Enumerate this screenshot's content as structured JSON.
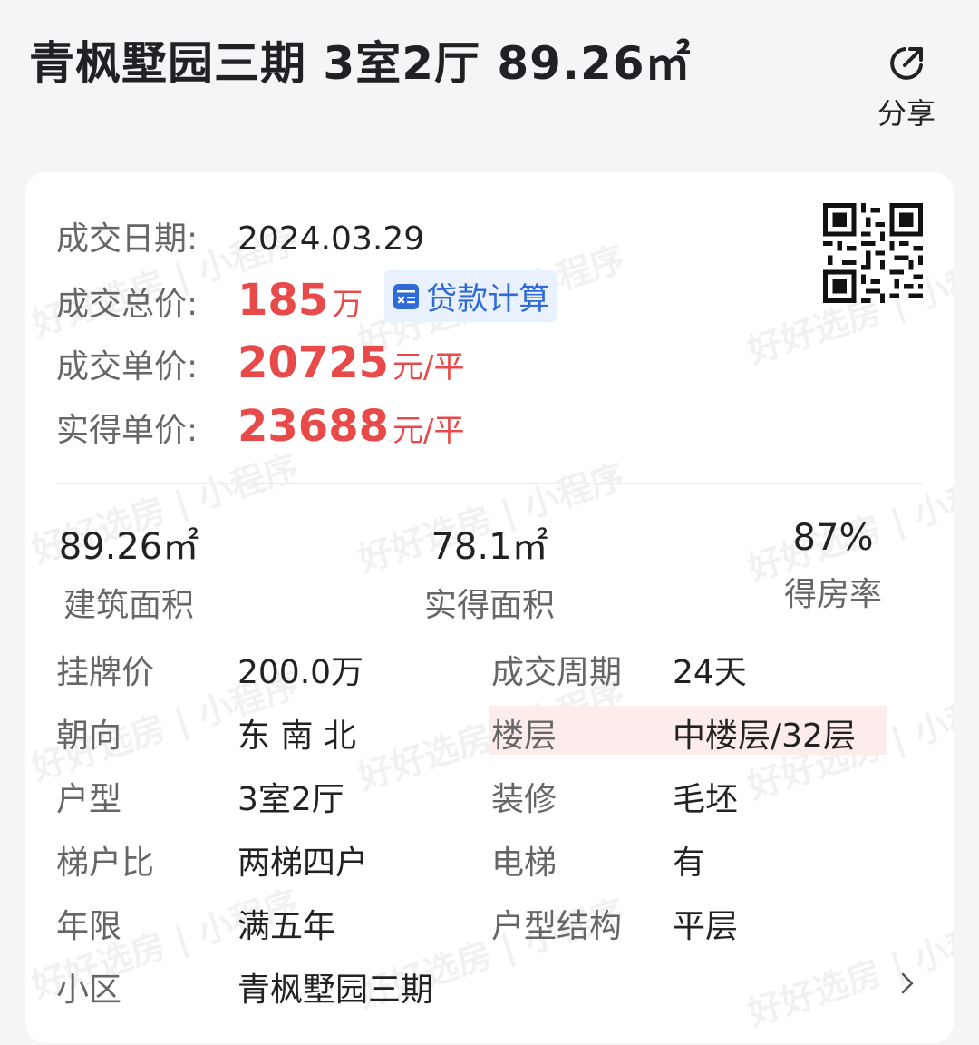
{
  "header": {
    "title": "青枫墅园三期 3室2厅 89.26㎡",
    "share_label": "分享"
  },
  "watermark_text": "好好选房 | 小程序",
  "deal": {
    "date_label": "成交日期:",
    "date_value": "2024.03.29",
    "total_label": "成交总价:",
    "total_value": "185",
    "total_unit": "万",
    "loan_button_label": "贷款计算",
    "unit_price_label": "成交单价:",
    "unit_price_value": "20725",
    "unit_price_unit": "元/平",
    "effective_price_label": "实得单价:",
    "effective_price_value": "23688",
    "effective_price_unit": "元/平"
  },
  "stats": [
    {
      "value": "89.26㎡",
      "label": "建筑面积"
    },
    {
      "value": "78.1㎡",
      "label": "实得面积"
    },
    {
      "value": "87%",
      "label": "得房率"
    }
  ],
  "details": {
    "listing_price_label": "挂牌价",
    "listing_price_value": "200.0万",
    "cycle_label": "成交周期",
    "cycle_value": "24天",
    "orientation_label": "朝向",
    "orientation_value": "东 南 北",
    "floor_label": "楼层",
    "floor_value": "中楼层/32层",
    "layout_label": "户型",
    "layout_value": "3室2厅",
    "decoration_label": "装修",
    "decoration_value": "毛坯",
    "elevator_ratio_label": "梯户比",
    "elevator_ratio_value": "两梯四户",
    "elevator_label": "电梯",
    "elevator_value": "有",
    "years_label": "年限",
    "years_value": "满五年",
    "structure_label": "户型结构",
    "structure_value": "平层",
    "community_label": "小区",
    "community_value": "青枫墅园三期"
  },
  "colors": {
    "price_red": "#e84a4a",
    "loan_blue": "#2f6bd8",
    "floor_highlight": "#fdecec"
  }
}
